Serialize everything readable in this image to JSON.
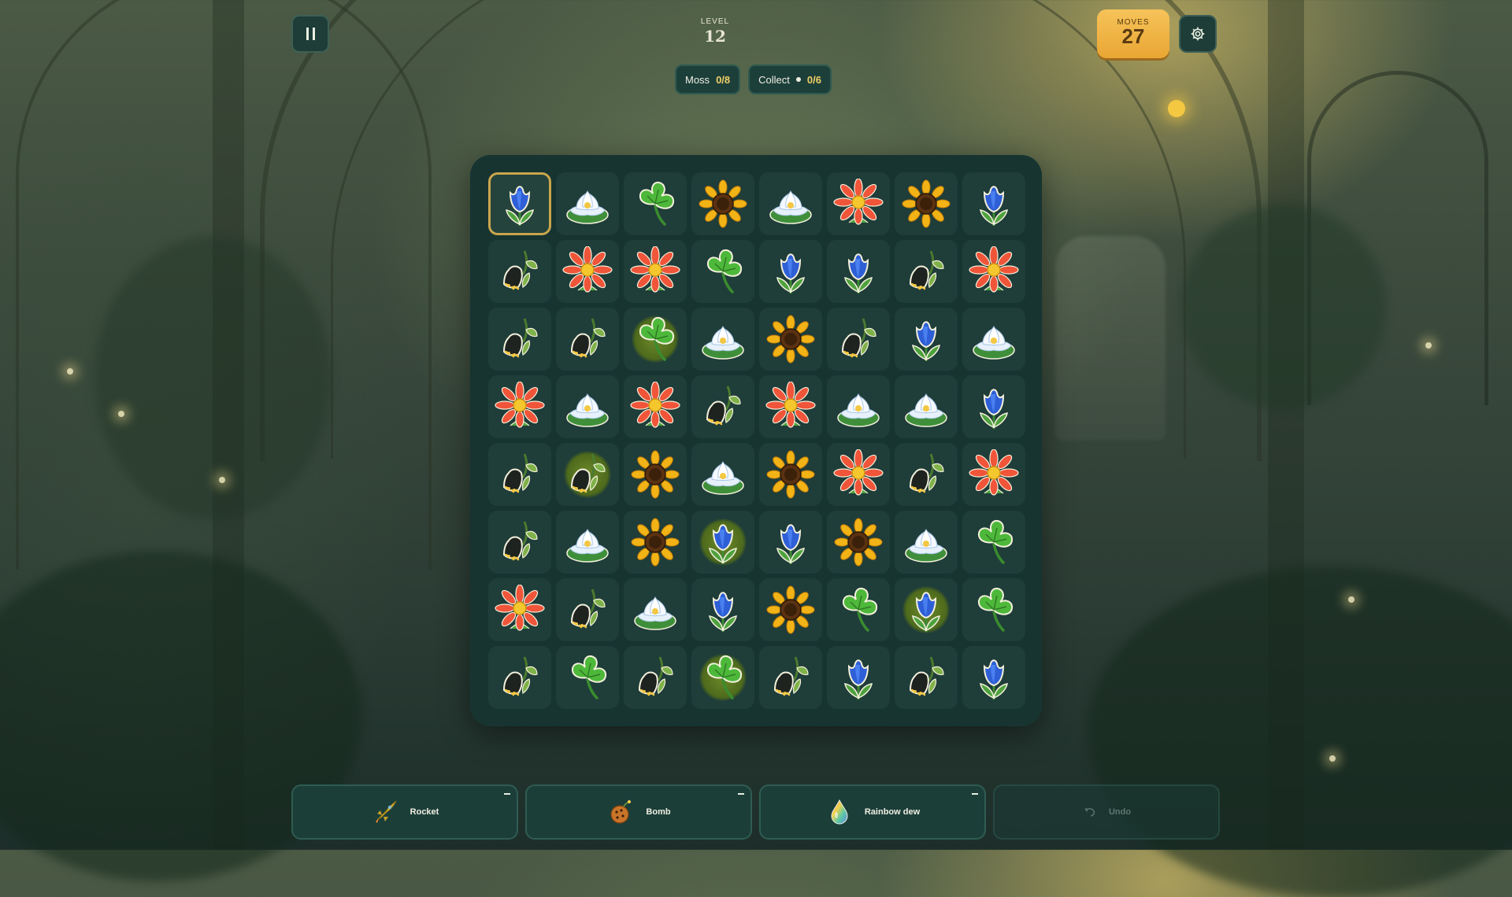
{
  "hud": {
    "pause_icon": "pause-icon",
    "settings_icon": "gear-icon",
    "level_label": "LEVEL",
    "level_value": "12",
    "moves_label": "MOVES",
    "moves_value": "27"
  },
  "goals": [
    {
      "label": "Moss",
      "count": "0/8"
    },
    {
      "label": "Collect",
      "count": "0/6"
    }
  ],
  "board": {
    "rows": 8,
    "cols": 8,
    "selected": [
      0,
      0
    ],
    "tiles": [
      [
        "tulip",
        "lotus",
        "clover",
        "sunflower",
        "lotus",
        "gerbera",
        "sunflower",
        "tulip"
      ],
      [
        "bellflower",
        "gerbera",
        "gerbera",
        "clover",
        "tulip",
        "tulip",
        "bellflower",
        "gerbera"
      ],
      [
        "bellflower",
        "bellflower",
        "clover",
        "lotus",
        "sunflower",
        "bellflower",
        "tulip",
        "lotus"
      ],
      [
        "gerbera",
        "lotus",
        "gerbera",
        "bellflower",
        "gerbera",
        "lotus",
        "lotus",
        "tulip"
      ],
      [
        "bellflower",
        "bellflower",
        "sunflower",
        "lotus",
        "sunflower",
        "gerbera",
        "bellflower",
        "gerbera"
      ],
      [
        "bellflower",
        "lotus",
        "sunflower",
        "tulip",
        "tulip",
        "sunflower",
        "lotus",
        "clover"
      ],
      [
        "gerbera",
        "bellflower",
        "lotus",
        "tulip",
        "sunflower",
        "clover",
        "tulip",
        "clover"
      ],
      [
        "bellflower",
        "clover",
        "bellflower",
        "clover",
        "bellflower",
        "tulip",
        "bellflower",
        "tulip"
      ]
    ],
    "moss": [
      [
        2,
        2
      ],
      [
        4,
        1
      ],
      [
        5,
        3
      ],
      [
        6,
        6
      ],
      [
        7,
        3
      ]
    ]
  },
  "powerups": [
    {
      "label": "Rocket",
      "icon": "rocket-icon",
      "enabled": true
    },
    {
      "label": "Bomb",
      "icon": "bomb-icon",
      "enabled": true
    },
    {
      "label": "Rainbow dew",
      "icon": "rainbow-dew-icon",
      "enabled": true
    },
    {
      "label": "Undo",
      "icon": "undo-icon",
      "enabled": false
    }
  ],
  "colors": {
    "accent_gold": "#f0cf66",
    "moves_badge": "#f6c35a",
    "panel": "#1c3f3a"
  }
}
